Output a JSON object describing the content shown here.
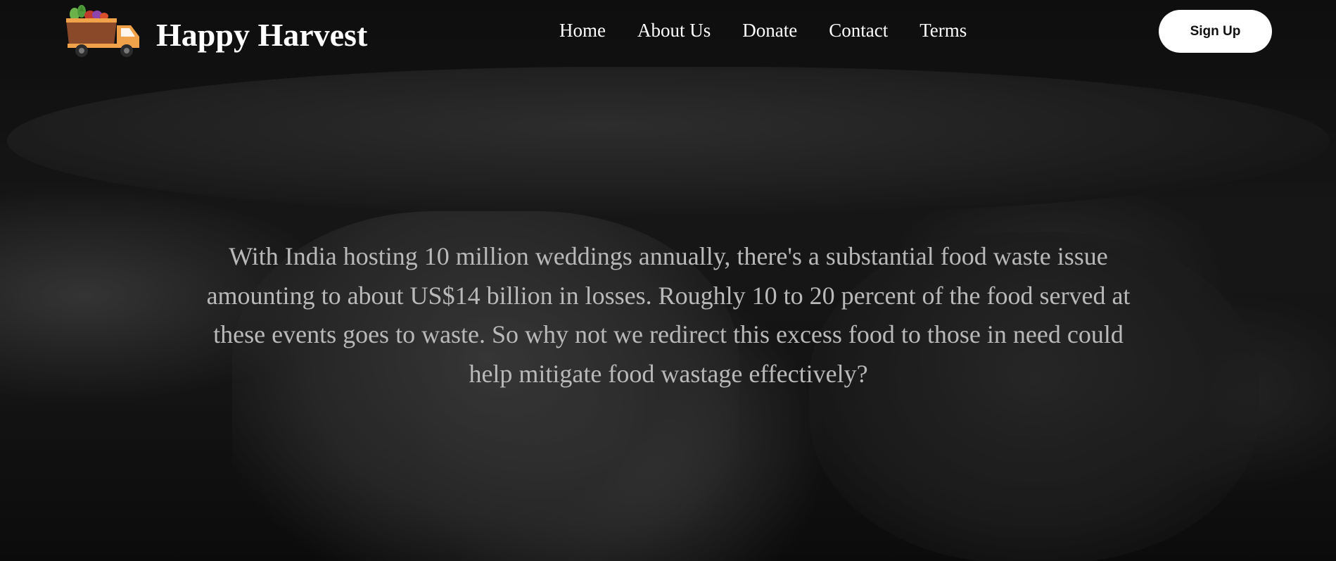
{
  "header": {
    "brand_name": "Happy Harvest",
    "logo_icon": "delivery-truck-with-vegetables-icon",
    "nav": [
      {
        "label": "Home"
      },
      {
        "label": "About Us"
      },
      {
        "label": "Donate"
      },
      {
        "label": "Contact"
      },
      {
        "label": "Terms"
      }
    ],
    "signup_label": "Sign Up"
  },
  "hero": {
    "background": "grayscale photo of people carrying a large basket",
    "message": "With India hosting 10 million weddings annually, there's a substantial food waste issue amounting to about US$14 billion in losses. Roughly 10 to 20 percent of the food served at these events goes to waste. So why not we redirect this excess food to those in need could help mitigate food wastage effectively?"
  },
  "colors": {
    "truck_body": "#f0a24a",
    "truck_cargo": "#8a4a2a",
    "text_primary": "#ffffff",
    "text_hero": "#b9b9b9",
    "button_bg": "#ffffff"
  }
}
